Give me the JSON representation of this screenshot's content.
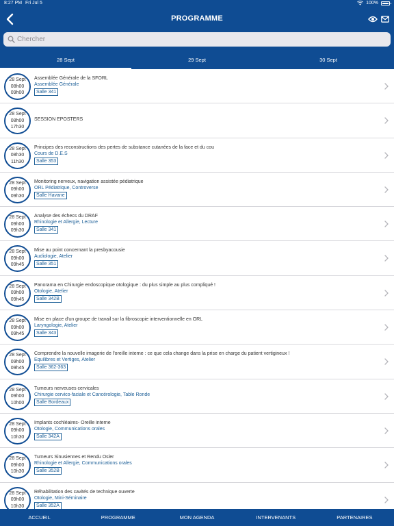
{
  "status_bar": {
    "time": "8:27 PM",
    "date": "Fri Jul 5",
    "battery": "100%"
  },
  "header": {
    "title": "PROGRAMME",
    "back_icon": "chevron-left-icon",
    "actions": [
      "eye-icon",
      "mail-icon"
    ]
  },
  "search": {
    "placeholder": "Chercher",
    "value": ""
  },
  "tabs": [
    {
      "label": "28 Sept",
      "active": true
    },
    {
      "label": "29 Sept",
      "active": false
    },
    {
      "label": "30 Sept",
      "active": false
    }
  ],
  "sessions": [
    {
      "date": "28 Sept",
      "start": "08h00",
      "end": "09h00",
      "title": "Assemblée Générale de la SFORL",
      "track": "Assemblée Générale",
      "room": "Salle 341"
    },
    {
      "date": "28 Sept",
      "start": "08h00",
      "end": "17h30",
      "title": "SESSION EPOSTERS",
      "track": "",
      "room": ""
    },
    {
      "date": "28 Sept",
      "start": "08h30",
      "end": "11h30",
      "title": "Principes des reconstructions des pertes de substance cutanées de la face et du cou",
      "track": "Cours de D.E.S",
      "room": "Salle 353"
    },
    {
      "date": "28 Sept",
      "start": "09h00",
      "end": "09h30",
      "title": "Monitoring nerveux, navigation assistée pédiatrique",
      "track": "ORL Pédiatrique, Controverse",
      "room": "Salle Havane"
    },
    {
      "date": "28 Sept",
      "start": "09h00",
      "end": "09h30",
      "title": "Analyse des échecs du DRAF",
      "track": "Rhinologie et Allergie, Lecture",
      "room": "Salle 341"
    },
    {
      "date": "28 Sept",
      "start": "09h00",
      "end": "09h45",
      "title": "Mise au point concernant la presbyacousie",
      "track": "Audiologie, Atelier",
      "room": "Salle 351"
    },
    {
      "date": "28 Sept",
      "start": "09h00",
      "end": "09h45",
      "title": "Panorama en Chirurgie endoscopique otologique : du plus simple au plus compliqué !",
      "track": "Otologie, Atelier",
      "room": "Salle 342B"
    },
    {
      "date": "28 Sept",
      "start": "09h00",
      "end": "09h45",
      "title": "Mise en place d'un groupe de travail sur la fibroscopie interventionnelle en ORL",
      "track": "Laryngologie, Atelier",
      "room": "Salle 343"
    },
    {
      "date": "28 Sept",
      "start": "09h00",
      "end": "09h45",
      "title": "Comprendre la nouvelle imagerie de l'oreille interne : ce que cela change dans la prise en charge du patient vertigineux !",
      "track": "Equilibres et Vertiges, Atelier",
      "room": "Salle 362-363"
    },
    {
      "date": "28 Sept",
      "start": "09h00",
      "end": "10h00",
      "title": "Tumeurs nerveuses cervicales",
      "track": "Chirurgie cervico-faciale et Cancérologie, Table Ronde",
      "room": "Salle Bordeaux"
    },
    {
      "date": "28 Sept",
      "start": "09h00",
      "end": "10h30",
      "title": "Implants cochléaires- Oreille interne",
      "track": "Otologie, Communications orales",
      "room": "Salle 342A"
    },
    {
      "date": "28 Sept",
      "start": "09h00",
      "end": "10h30",
      "title": "Tumeurs Sinusiennes et Rendu Osler",
      "track": "Rhinologie et Allergie, Communications orales",
      "room": "Salle 352B"
    },
    {
      "date": "28 Sept",
      "start": "09h00",
      "end": "10h30",
      "title": " Réhabilitation des cavités de technique ouverte",
      "track": "Otologie, Mini-Séminaire",
      "room": "Salle 352A"
    }
  ],
  "bottom_nav": [
    {
      "label": "ACCUEIL"
    },
    {
      "label": "PROGRAMME"
    },
    {
      "label": "MON AGENDA"
    },
    {
      "label": "INTERVENANTS"
    },
    {
      "label": "PARTENAIRES"
    }
  ],
  "colors": {
    "primary": "#0f4c93",
    "link": "#1e6098",
    "separator": "#d7d7dc"
  }
}
